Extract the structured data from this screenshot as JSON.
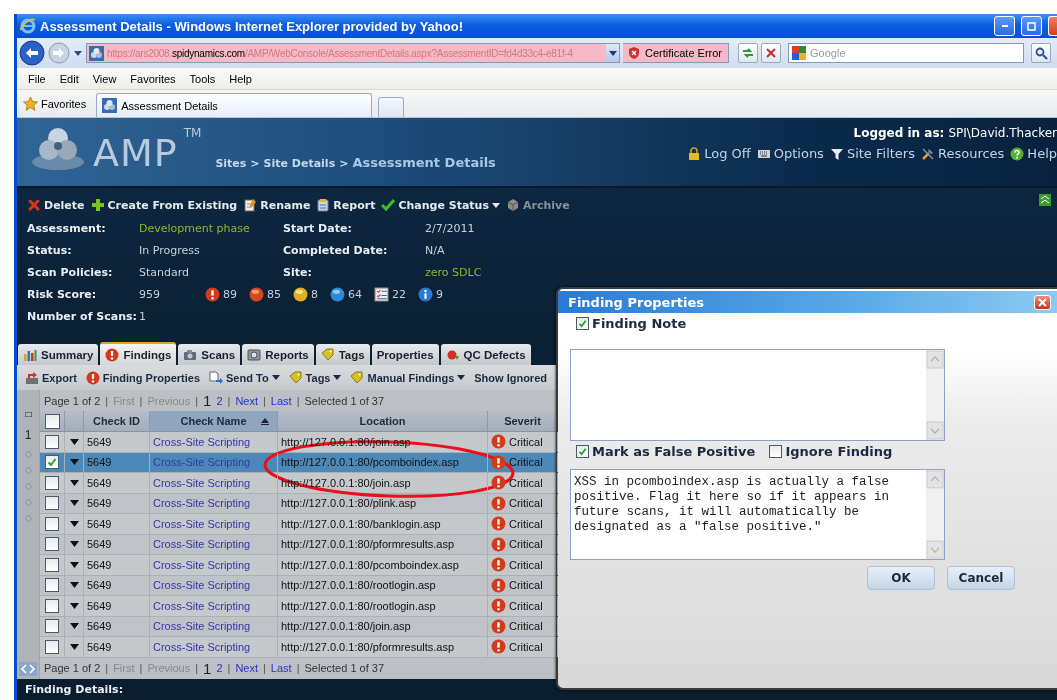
{
  "browser": {
    "title": "Assessment Details - Windows Internet Explorer provided by Yahoo!",
    "address": {
      "prefix": "https://ars2008.",
      "domain": "spidynamics.com",
      "path": "/AMP/WebConsole/AssessmentDetails.aspx?AssessmentID=fd4d33c4-e81f-4"
    },
    "certificate_error": "Certificate Error",
    "search": {
      "placeholder": "Google"
    },
    "menu": [
      "File",
      "Edit",
      "View",
      "Favorites",
      "Tools",
      "Help"
    ],
    "favorites": "Favorites",
    "tabs": [
      {
        "label": "Assessment Details",
        "selected": true
      }
    ]
  },
  "app": {
    "logo": "AMP",
    "logo_mark": "TM",
    "breadcrumb": {
      "separator": ">",
      "items": [
        {
          "label": "Sites",
          "selected": false
        },
        {
          "label": "Site Details",
          "selected": false
        },
        {
          "label": "Assessment Details",
          "selected": true
        }
      ]
    },
    "logged_in_label": "Logged in as:",
    "user": "SPI\\David.Thacker",
    "header_links": [
      "Log Off",
      "Options",
      "Site Filters",
      "Resources",
      "Help"
    ]
  },
  "actions": [
    {
      "label": "Delete",
      "dropdown": false,
      "disabled": false
    },
    {
      "label": "Create From Existing",
      "dropdown": false,
      "disabled": false
    },
    {
      "label": "Rename",
      "dropdown": false,
      "disabled": false
    },
    {
      "label": "Report",
      "dropdown": false,
      "disabled": false
    },
    {
      "label": "Change Status",
      "dropdown": true,
      "disabled": false
    },
    {
      "label": "Archive",
      "dropdown": false,
      "disabled": true
    }
  ],
  "details": {
    "left": [
      {
        "label": "Assessment:",
        "value": "Development phase",
        "link": true
      },
      {
        "label": "Status:",
        "value": "In Progress",
        "link": false
      },
      {
        "label": "Scan Policies:",
        "value": "Standard",
        "link": false
      },
      {
        "label": "Risk Score:",
        "value": "959",
        "link": false,
        "counts": [
          {
            "kind": "critical",
            "count": "89"
          },
          {
            "kind": "high",
            "count": "85"
          },
          {
            "kind": "medium",
            "count": "8"
          },
          {
            "kind": "low",
            "count": "64"
          },
          {
            "kind": "best_practice",
            "count": "22"
          },
          {
            "kind": "info",
            "count": "9"
          }
        ]
      },
      {
        "label": "Number of Scans:",
        "value": "1",
        "link": false
      }
    ],
    "right": [
      {
        "label": "Start Date:",
        "value": "2/7/2011",
        "link": false
      },
      {
        "label": "Completed Date:",
        "value": "N/A",
        "link": false
      },
      {
        "label": "Site:",
        "value": "zero SDLC",
        "link": true
      }
    ]
  },
  "tabs": [
    {
      "label": "Summary",
      "selected": false
    },
    {
      "label": "Findings",
      "selected": true
    },
    {
      "label": "Scans",
      "selected": false
    },
    {
      "label": "Reports",
      "selected": false
    },
    {
      "label": "Tags",
      "selected": false
    },
    {
      "label": "Properties",
      "selected": false
    },
    {
      "label": "QC Defects",
      "selected": false
    }
  ],
  "toolbar": [
    {
      "label": "Export",
      "dropdown": false
    },
    {
      "label": "Finding Properties",
      "dropdown": false
    },
    {
      "label": "Send To",
      "dropdown": true
    },
    {
      "label": "Tags",
      "dropdown": true
    },
    {
      "label": "Manual Findings",
      "dropdown": true
    },
    {
      "label": "Show Ignored",
      "dropdown": false
    }
  ],
  "pagers": [
    {
      "separator": "|",
      "page_info": "Page 1 of 2",
      "before": [
        {
          "label": "First",
          "disabled": true
        },
        {
          "label": "Previous",
          "disabled": true
        }
      ],
      "pages": [
        {
          "label": "1",
          "selected": true
        },
        {
          "label": "2",
          "selected": false
        }
      ],
      "after": [
        {
          "label": "Next",
          "disabled": false
        },
        {
          "label": "Last",
          "disabled": false
        }
      ],
      "selection": "Selected 1 of 37"
    },
    {
      "separator": "|",
      "page_info": "Page 1 of 2",
      "before": [
        {
          "label": "First",
          "disabled": true
        },
        {
          "label": "Previous",
          "disabled": true
        }
      ],
      "pages": [
        {
          "label": "1",
          "selected": true
        },
        {
          "label": "2",
          "selected": false
        }
      ],
      "after": [
        {
          "label": "Next",
          "disabled": false
        },
        {
          "label": "Last",
          "disabled": false
        }
      ],
      "selection": "Selected 1 of 37"
    }
  ],
  "gutter": {
    "label": "1"
  },
  "table": {
    "select_all": {
      "checked": false
    },
    "columns": [
      {
        "label": "Check ID",
        "sorted": false
      },
      {
        "label": "Check Name",
        "sorted": true
      },
      {
        "label": "Location",
        "sorted": false
      },
      {
        "label": "Severit",
        "sorted": false
      }
    ],
    "rows": [
      {
        "checked": false,
        "selected": false,
        "check_id": "5649",
        "check_name": "Cross-Site Scripting",
        "location": "http://127.0.0.1:80/join.asp",
        "severity": "Critical",
        "kind": "critical"
      },
      {
        "checked": true,
        "selected": true,
        "check_id": "5649",
        "check_name": "Cross-Site Scripting",
        "location": "http://127.0.0.1:80/pcomboindex.asp",
        "severity": "Critical",
        "kind": "critical"
      },
      {
        "checked": false,
        "selected": false,
        "check_id": "5649",
        "check_name": "Cross-Site Scripting",
        "location": "http://127.0.0.1:80/join.asp",
        "severity": "Critical",
        "kind": "critical"
      },
      {
        "checked": false,
        "selected": false,
        "check_id": "5649",
        "check_name": "Cross-Site Scripting",
        "location": "http://127.0.0.1:80/plink.asp",
        "severity": "Critical",
        "kind": "critical"
      },
      {
        "checked": false,
        "selected": false,
        "check_id": "5649",
        "check_name": "Cross-Site Scripting",
        "location": "http://127.0.0.1:80/banklogin.asp",
        "severity": "Critical",
        "kind": "critical"
      },
      {
        "checked": false,
        "selected": false,
        "check_id": "5649",
        "check_name": "Cross-Site Scripting",
        "location": "http://127.0.0.1:80/pformresults.asp",
        "severity": "Critical",
        "kind": "critical"
      },
      {
        "checked": false,
        "selected": false,
        "check_id": "5649",
        "check_name": "Cross-Site Scripting",
        "location": "http://127.0.0.1:80/pcomboindex.asp",
        "severity": "Critical",
        "kind": "critical"
      },
      {
        "checked": false,
        "selected": false,
        "check_id": "5649",
        "check_name": "Cross-Site Scripting",
        "location": "http://127.0.0.1:80/rootlogin.asp",
        "severity": "Critical",
        "kind": "critical"
      },
      {
        "checked": false,
        "selected": false,
        "check_id": "5649",
        "check_name": "Cross-Site Scripting",
        "location": "http://127.0.0.1:80/rootlogin.asp",
        "severity": "Critical",
        "kind": "critical"
      },
      {
        "checked": false,
        "selected": false,
        "check_id": "5649",
        "check_name": "Cross-Site Scripting",
        "location": "http://127.0.0.1:80/join.asp",
        "severity": "Critical",
        "kind": "critical"
      },
      {
        "checked": false,
        "selected": false,
        "check_id": "5649",
        "check_name": "Cross-Site Scripting",
        "location": "http://127.0.0.1:80/pformresults.asp",
        "severity": "Critical",
        "kind": "critical"
      }
    ]
  },
  "footer": {
    "title": "Finding Details:"
  },
  "dialog": {
    "title": "Finding Properties",
    "note_toggle": {
      "label": "Finding Note",
      "checked": true
    },
    "options": [
      {
        "label": "Mark as False Positive",
        "checked": true
      },
      {
        "label": "Ignore Finding",
        "checked": false
      }
    ],
    "comment": "XSS in pcomboindex.asp is actually a false positive. Flag it here so if it appears in future scans, it will automatically be designated as a \"false positive.\"",
    "buttons": [
      "OK",
      "Cancel"
    ]
  },
  "annotation": {
    "kind": "ellipse"
  }
}
